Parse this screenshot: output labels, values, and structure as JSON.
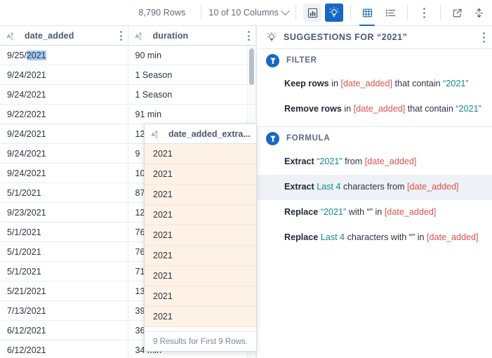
{
  "toolbar": {
    "rows_count": "8,790 Rows",
    "columns_select": "10 of 10 Columns",
    "chevron_icon": "chevron-down-icon",
    "chart_button": "chart-icon",
    "insights_button": "lightbulb-icon",
    "grid_view_button": "table-grid-icon",
    "list_view_button": "list-icon",
    "more_button": "kebab-menu-icon",
    "open_external_button": "external-link-icon",
    "collapse_button": "collapse-vertical-icon",
    "accent_color": "#1668c3"
  },
  "grid": {
    "columns": [
      {
        "name": "date_added",
        "type_icon": "abc-text-type-icon"
      },
      {
        "name": "duration",
        "type_icon": "abc-text-type-icon"
      }
    ],
    "rows": [
      {
        "date_prefix": "9/25/",
        "date_selected": "2021",
        "duration": "90 min"
      },
      {
        "date_prefix": "9/24/2021",
        "date_selected": "",
        "duration": "1 Season"
      },
      {
        "date_prefix": "9/24/2021",
        "date_selected": "",
        "duration": "1 Season"
      },
      {
        "date_prefix": "9/22/2021",
        "date_selected": "",
        "duration": "91 min"
      },
      {
        "date_prefix": "9/24/2021",
        "date_selected": "",
        "duration": "12"
      },
      {
        "date_prefix": "9/24/2021",
        "date_selected": "",
        "duration": "9 "
      },
      {
        "date_prefix": "9/24/2021",
        "date_selected": "",
        "duration": "10"
      },
      {
        "date_prefix": "5/1/2021",
        "date_selected": "",
        "duration": "87"
      },
      {
        "date_prefix": "9/23/2021",
        "date_selected": "",
        "duration": "12"
      },
      {
        "date_prefix": "5/1/2021",
        "date_selected": "",
        "duration": "76"
      },
      {
        "date_prefix": "5/1/2021",
        "date_selected": "",
        "duration": "76"
      },
      {
        "date_prefix": "5/1/2021",
        "date_selected": "",
        "duration": "71"
      },
      {
        "date_prefix": "5/21/2021",
        "date_selected": "",
        "duration": "13"
      },
      {
        "date_prefix": "7/13/2021",
        "date_selected": "",
        "duration": "39"
      },
      {
        "date_prefix": "6/12/2021",
        "date_selected": "",
        "duration": "36"
      },
      {
        "date_prefix": "6/12/2021",
        "date_selected": "",
        "duration": "34 min"
      }
    ]
  },
  "preview": {
    "column_title": "date_added_extra...",
    "type_icon": "abc-text-type-icon",
    "values": [
      "2021",
      "2021",
      "2021",
      "2021",
      "2021",
      "2021",
      "2021",
      "2021",
      "2021"
    ],
    "footer": "9 Results for First 9 Rows."
  },
  "suggestions": {
    "header_title": "SUGGESTIONS FOR “2021”",
    "header_icon": "lightbulb-icon",
    "menu_icon": "kebab-menu-icon",
    "sections": [
      {
        "label": "FILTER",
        "icon": "filter-funnel-icon",
        "items": [
          {
            "action": "Keep rows",
            "mid1": " in ",
            "column": "[date_added]",
            "mid2": " that contain ",
            "value": "“2021”",
            "tail": "",
            "hovered": false
          },
          {
            "action": "Remove rows",
            "mid1": " in ",
            "column": "[date_added]",
            "mid2": " that contain ",
            "value": "“2021”",
            "tail": "",
            "hovered": false
          }
        ]
      },
      {
        "label": "FORMULA",
        "icon": "filter-funnel-icon",
        "items": [
          {
            "action": "Extract",
            "mid1": " ",
            "value": "“2021”",
            "mid2": " from ",
            "column": "[date_added]",
            "tail": "",
            "hovered": false
          },
          {
            "action": "Extract",
            "mid1": " ",
            "value": "Last 4",
            "mid2": " characters from ",
            "column": "[date_added]",
            "tail": "",
            "hovered": true
          },
          {
            "action": "Replace",
            "mid1": " ",
            "value": "“2021”",
            "mid2": " with “” in ",
            "column": "[date_added]",
            "tail": "",
            "hovered": false
          },
          {
            "action": "Replace",
            "mid1": " ",
            "value": "Last 4",
            "mid2": " characters with “” in ",
            "column": "[date_added]",
            "tail": "",
            "hovered": false
          }
        ]
      }
    ]
  },
  "colors": {
    "accent": "#1668c3",
    "column_token": "#d9534f",
    "value_token": "#17888f",
    "selection": "#a8caf2",
    "preview_row": "#fdf2e5"
  }
}
